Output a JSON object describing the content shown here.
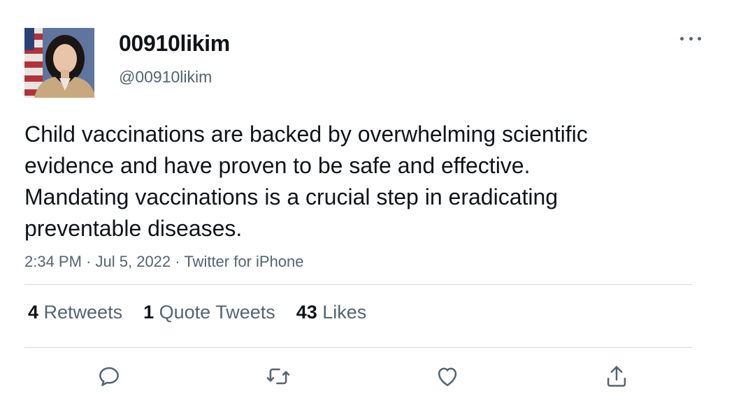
{
  "user": {
    "display_name": "00910likim",
    "handle": "@00910likim"
  },
  "tweet": {
    "text": "Child vaccinations are backed by overwhelming scientific evidence and have proven to be safe and effective. Mandating vaccinations is a crucial step in eradicating preventable diseases.",
    "time": "2:34 PM",
    "date": "Jul 5, 2022",
    "client": "Twitter for iPhone",
    "separator": "·"
  },
  "stats": {
    "retweets_count": "4",
    "retweets_label": "Retweets",
    "quotes_count": "1",
    "quotes_label": "Quote Tweets",
    "likes_count": "43",
    "likes_label": "Likes"
  },
  "icons": {
    "more": "more-dots-icon",
    "reply": "reply-icon",
    "retweet": "retweet-icon",
    "like": "heart-icon",
    "share": "share-icon"
  },
  "colors": {
    "text_primary": "#0f1419",
    "text_secondary": "#536471",
    "divider": "#cfd9de"
  }
}
